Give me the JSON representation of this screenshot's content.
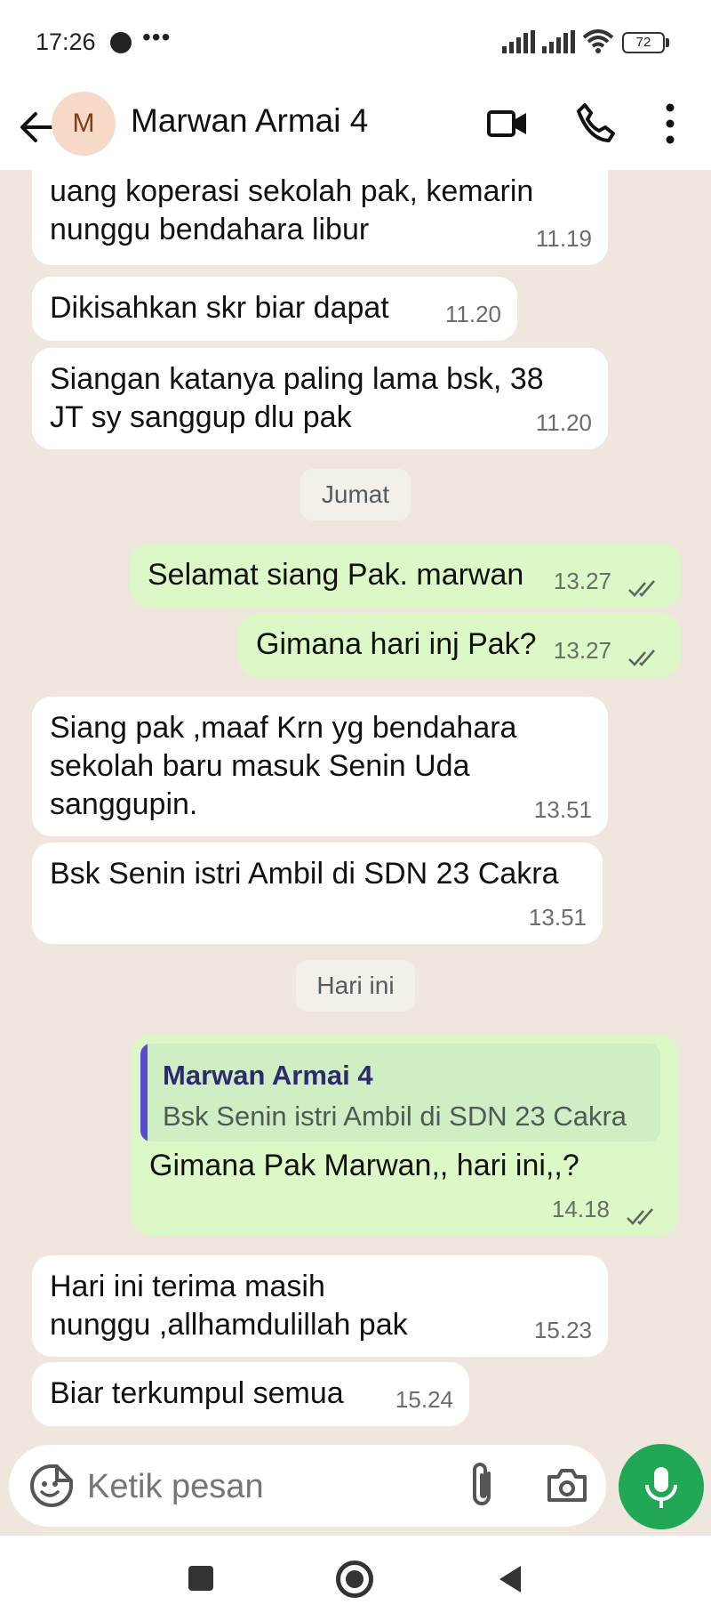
{
  "status": {
    "time": "17:26",
    "battery": "72"
  },
  "header": {
    "avatar_letter": "M",
    "name": "Marwan Armai 4"
  },
  "messages": [
    {
      "type": "in",
      "text": "bsk Jumat ,mau dikasi minjam\nuang koperasi sekolah pak, kemarin\nnunggu bendahara libur",
      "time": "11.19"
    },
    {
      "type": "in",
      "text": "Dikisahkan skr biar dapat",
      "time": "11.20"
    },
    {
      "type": "in",
      "text": "Siangan katanya paling lama bsk, 38\nJT sy sanggup dlu pak",
      "time": "11.20"
    },
    {
      "type": "date",
      "text": "Jumat"
    },
    {
      "type": "out",
      "text": "Selamat siang Pak. marwan",
      "time": "13.27"
    },
    {
      "type": "out",
      "text": "Gimana hari inj Pak?",
      "time": "13.27"
    },
    {
      "type": "in",
      "text": "Siang pak ,maaf Krn yg bendahara\nsekolah baru masuk Senin Uda\nsanggupin.",
      "time": "13.51"
    },
    {
      "type": "in",
      "text": "Bsk Senin istri Ambil di SDN 23 Cakra",
      "time": "13.51"
    },
    {
      "type": "date",
      "text": "Hari ini"
    },
    {
      "type": "out",
      "reply_name": "Marwan Armai 4",
      "reply_text": "Bsk Senin istri Ambil di SDN 23 Cakra",
      "text": "Gimana Pak Marwan,, hari ini,,?",
      "time": "14.18"
    },
    {
      "type": "in",
      "text": "Hari ini terima masih\nnunggu ,allhamdulillah pak",
      "time": "15.23"
    },
    {
      "type": "in",
      "text": "Biar terkumpul semua",
      "time": "15.24"
    }
  ],
  "composer": {
    "placeholder": "Ketik pesan"
  },
  "colors": {
    "incoming": "#ffffff",
    "outgoing": "#dbf8c6",
    "accent": "#20a856",
    "chat_bg": "#efe7dd"
  }
}
